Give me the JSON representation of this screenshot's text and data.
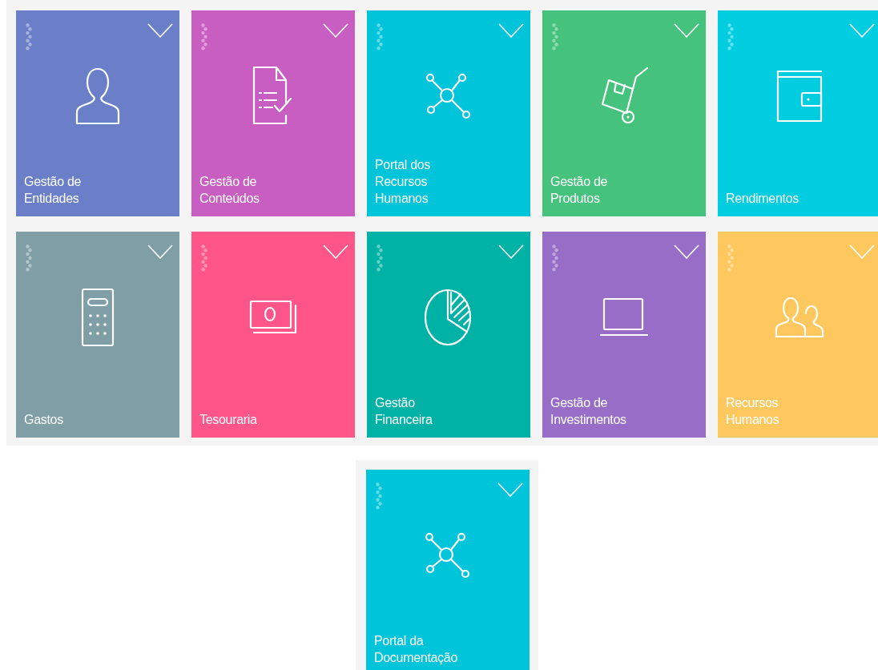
{
  "tiles": [
    {
      "label": "Gestão de\nEntidades",
      "color": "#6b7fc9"
    },
    {
      "label": "Gestão de\nConteúdos",
      "color": "#c95ec2"
    },
    {
      "label": "Portal dos\nRecursos\nHumanos",
      "color": "#00c4da"
    },
    {
      "label": "Gestão de\nProdutos",
      "color": "#45c27c"
    },
    {
      "label": "Rendimentos",
      "color": "#00cde0"
    },
    {
      "label": "Gastos",
      "color": "#7f9ea6"
    },
    {
      "label": "Tesouraria",
      "color": "#ff5588"
    },
    {
      "label": "Gestão\nFinanceira",
      "color": "#00b2a6"
    },
    {
      "label": "Gestão de\nInvestimentos",
      "color": "#986dc8"
    },
    {
      "label": "Recursos\nHumanos",
      "color": "#fec85e"
    }
  ],
  "extra_tiles": [
    {
      "label": "Portal da\nDocumentação",
      "color": "#00c4da"
    }
  ]
}
